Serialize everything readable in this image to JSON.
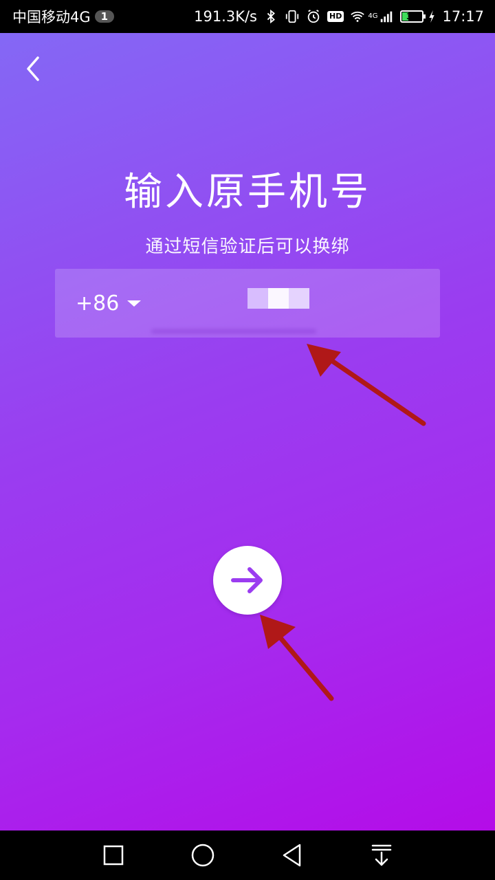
{
  "status_bar": {
    "carrier": "中国移动4G",
    "sim_badge": "1",
    "net_speed": "191.3K/s",
    "hd_label": "HD",
    "network_type": "4G",
    "battery_level": "31",
    "time": "17:17",
    "icons": [
      "bluetooth-icon",
      "vibrate-icon",
      "alarm-icon",
      "hd-icon",
      "wifi-icon",
      "signal-icon",
      "battery-icon",
      "charging-icon"
    ]
  },
  "header": {
    "back_icon": "chevron-left-icon"
  },
  "main": {
    "title": "输入原手机号",
    "subtitle": "通过短信验证后可以换绑",
    "country_code": "+86",
    "phone_input_value": "",
    "next_icon": "arrow-right-icon",
    "accent_color": "#9b3cf0"
  },
  "nav_bar": {
    "icons": [
      "recent-apps-icon",
      "home-icon",
      "back-icon",
      "notification-pull-icon"
    ]
  }
}
